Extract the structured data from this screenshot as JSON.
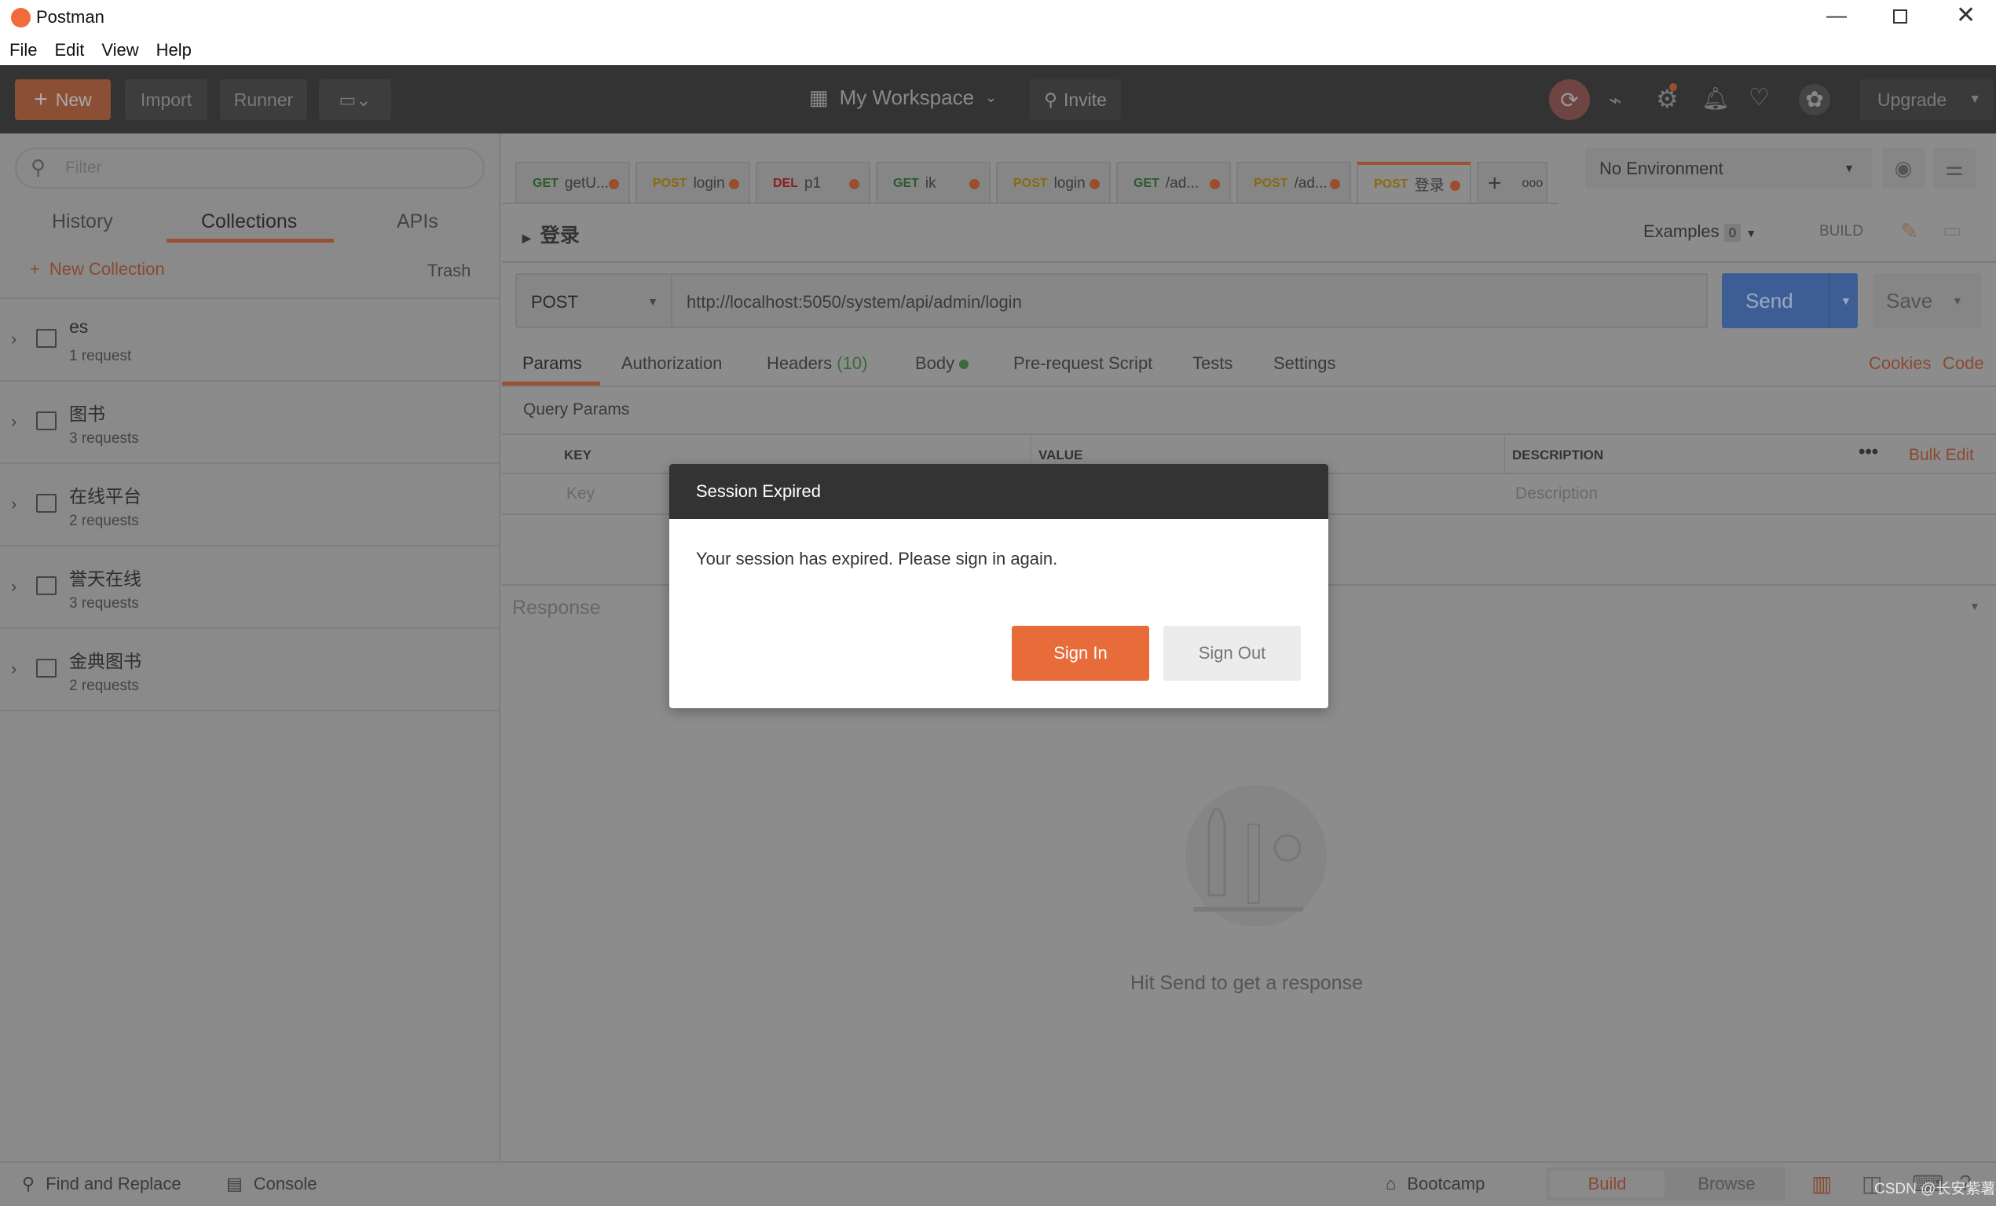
{
  "window": {
    "title": "Postman",
    "controls": [
      "minimize",
      "maximize",
      "close"
    ]
  },
  "menu": [
    "File",
    "Edit",
    "View",
    "Help"
  ],
  "header": {
    "new": "New",
    "import": "Import",
    "runner": "Runner",
    "workspace": "My Workspace",
    "invite": "Invite",
    "upgrade": "Upgrade"
  },
  "sidebar": {
    "filter_placeholder": "Filter",
    "tabs": [
      "History",
      "Collections",
      "APIs"
    ],
    "active_tab": "Collections",
    "new_collection": "New Collection",
    "trash": "Trash",
    "collections": [
      {
        "name": "es",
        "count": "1 request"
      },
      {
        "name": "图书",
        "count": "3 requests"
      },
      {
        "name": "在线平台",
        "count": "2 requests"
      },
      {
        "name": "誉天在线",
        "count": "3 requests"
      },
      {
        "name": "金典图书",
        "count": "2 requests"
      }
    ]
  },
  "request_tabs": [
    {
      "method": "GET",
      "name": "getU..."
    },
    {
      "method": "POST",
      "name": "login"
    },
    {
      "method": "DEL",
      "name": "p1"
    },
    {
      "method": "GET",
      "name": "ik"
    },
    {
      "method": "POST",
      "name": "login"
    },
    {
      "method": "GET",
      "name": "/ad..."
    },
    {
      "method": "POST",
      "name": "/ad..."
    },
    {
      "method": "POST",
      "name": "登录"
    }
  ],
  "environment": "No Environment",
  "request": {
    "title": "登录",
    "examples_label": "Examples",
    "examples_count": "0",
    "build": "BUILD",
    "method": "POST",
    "url": "http://localhost:5050/system/api/admin/login",
    "send": "Send",
    "save": "Save",
    "tabs": [
      "Params",
      "Authorization",
      "Headers",
      "Body",
      "Pre-request Script",
      "Tests",
      "Settings"
    ],
    "headers_count": "(10)",
    "cookies": "Cookies",
    "code": "Code",
    "query_params": "Query Params",
    "table": {
      "key": "KEY",
      "value": "VALUE",
      "description": "DESCRIPTION",
      "bulk_edit": "Bulk Edit",
      "key_placeholder": "Key",
      "description_placeholder": "Description"
    }
  },
  "response": {
    "label": "Response",
    "empty_text": "Hit Send to get a response"
  },
  "bottom": {
    "find_replace": "Find and Replace",
    "console": "Console",
    "bootcamp": "Bootcamp",
    "build": "Build",
    "browse": "Browse",
    "watermark": "CSDN @长安紫薯"
  },
  "dialog": {
    "title": "Session Expired",
    "message": "Your session has expired. Please sign in again.",
    "sign_in": "Sign In",
    "sign_out": "Sign Out"
  },
  "colors": {
    "brand": "#e86c3a",
    "send": "#3d5e94",
    "header": "#333333",
    "overlay_bg": "#8a8a8a"
  }
}
